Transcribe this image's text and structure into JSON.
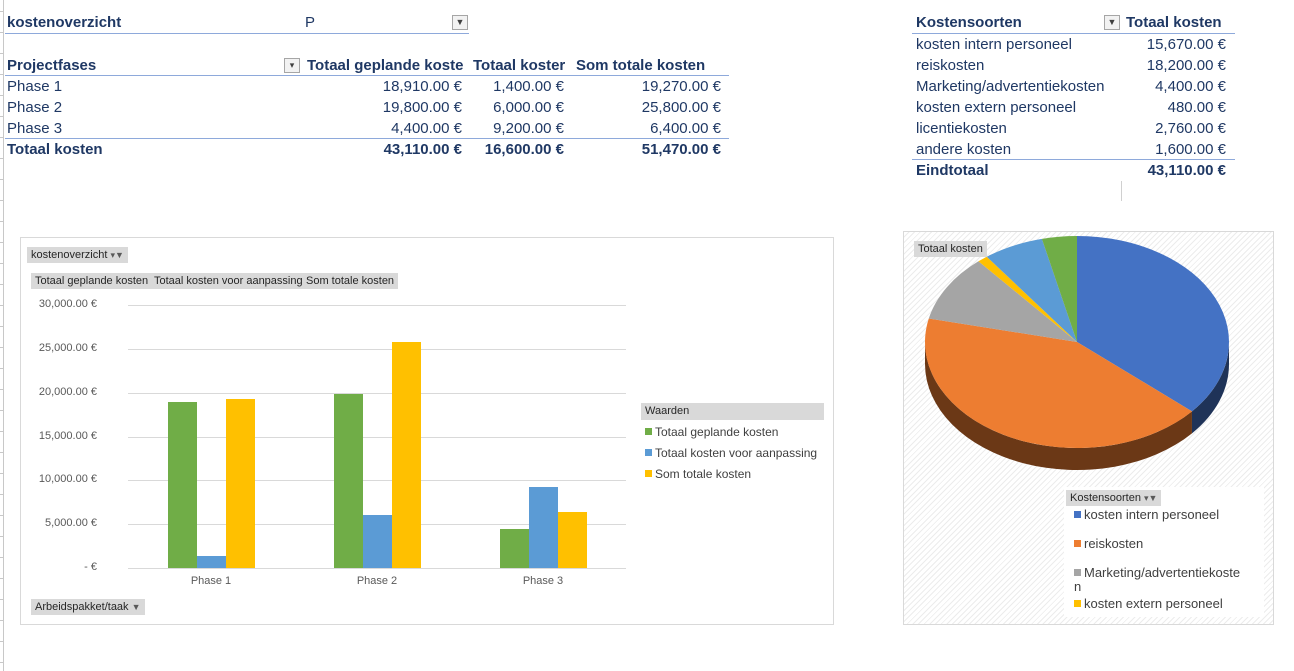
{
  "filter_area": {
    "label": "kostenoverzicht",
    "value": "P"
  },
  "pivot_projectfases": {
    "headers": [
      "Projectfases",
      "Totaal geplande koste",
      "Totaal koster",
      "Som totale kosten"
    ],
    "rows": [
      {
        "label": "Phase 1",
        "values": [
          "18,910.00 €",
          "1,400.00 €",
          "19,270.00 €"
        ]
      },
      {
        "label": "Phase 2",
        "values": [
          "19,800.00 €",
          "6,000.00 €",
          "25,800.00 €"
        ]
      },
      {
        "label": "Phase 3",
        "values": [
          "4,400.00 €",
          "9,200.00 €",
          "6,400.00 €"
        ]
      }
    ],
    "total": {
      "label": "Totaal kosten",
      "values": [
        "43,110.00 €",
        "16,600.00 €",
        "51,470.00 €"
      ]
    }
  },
  "pivot_kostensoorten": {
    "headers": [
      "Kostensoorten",
      "Totaal kosten"
    ],
    "rows": [
      {
        "label": "kosten intern personeel",
        "value": "15,670.00 €"
      },
      {
        "label": "reiskosten",
        "value": "18,200.00 €"
      },
      {
        "label": "Marketing/advertentiekosten",
        "value": "4,400.00 €"
      },
      {
        "label": "kosten extern personeel",
        "value": "480.00 €"
      },
      {
        "label": "licentiekosten",
        "value": "2,760.00 €"
      },
      {
        "label": "andere kosten",
        "value": "1,600.00 €"
      }
    ],
    "total": {
      "label": "Eindtotaal",
      "value": "43,110.00 €"
    }
  },
  "bar_chart_ui": {
    "filter_button": "kostenoverzicht",
    "value_buttons": [
      "Totaal geplande kosten",
      "Totaal kosten voor aanpassing",
      "Som  totale kosten"
    ],
    "axis_button": "Arbeidspakket/taak",
    "legend_title": "Waarden"
  },
  "pie_chart_ui": {
    "value_button": "Totaal kosten",
    "legend_title": "Kostensoorten",
    "legend_items": [
      "kosten intern personeel",
      "reiskosten",
      "Marketing/advertentiekoste\nn",
      "kosten extern personeel"
    ]
  },
  "chart_data": [
    {
      "type": "bar",
      "title": "",
      "categories": [
        "Phase 1",
        "Phase 2",
        "Phase 3"
      ],
      "series": [
        {
          "name": "Totaal geplande kosten",
          "color": "#70ad47",
          "values": [
            18910,
            19800,
            4400
          ]
        },
        {
          "name": "Totaal kosten voor aanpassing",
          "color": "#5b9bd5",
          "values": [
            1400,
            6000,
            9200
          ]
        },
        {
          "name": "Som totale kosten",
          "color": "#ffc000",
          "values": [
            19270,
            25800,
            6400
          ]
        }
      ],
      "yticks": [
        "-  €",
        "5,000.00 €",
        "10,000.00 €",
        "15,000.00 €",
        "20,000.00 €",
        "25,000.00 €",
        "30,000.00 €"
      ],
      "ylim": [
        0,
        30000
      ],
      "grid": true,
      "legend": "right"
    },
    {
      "type": "pie",
      "title": "Totaal kosten",
      "labels": [
        "kosten intern personeel",
        "reiskosten",
        "Marketing/advertentiekosten",
        "kosten extern personeel",
        "licentiekosten",
        "andere kosten"
      ],
      "values": [
        15670,
        18200,
        4400,
        480,
        2760,
        1600
      ],
      "colors": [
        "#4472c4",
        "#ed7d31",
        "#a5a5a5",
        "#ffc000",
        "#5b9bd5",
        "#70ad47"
      ],
      "legend": "bottom-right"
    }
  ]
}
